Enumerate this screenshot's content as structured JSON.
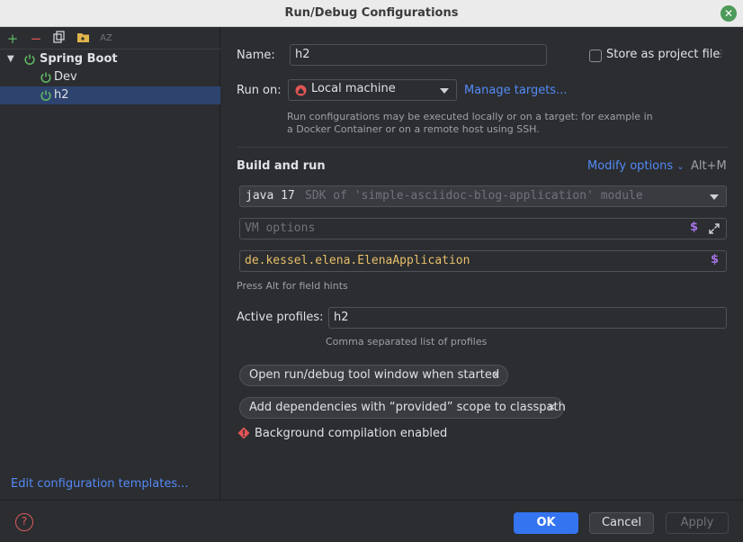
{
  "window": {
    "title": "Run/Debug Configurations"
  },
  "sidebar": {
    "toolbar": [
      {
        "name": "add",
        "glyph": "+",
        "color": "#5fb865"
      },
      {
        "name": "remove",
        "glyph": "−",
        "color": "#e05555"
      },
      {
        "name": "copy",
        "glyph": "❐",
        "color": "#ced0d6"
      },
      {
        "name": "folder",
        "glyph": "▣",
        "color": "#e0b44c"
      },
      {
        "name": "sort",
        "glyph": "AZ",
        "color": "#6f737a"
      }
    ],
    "tree": [
      {
        "label": "Spring Boot",
        "level": 0,
        "expanded": true,
        "selected": false
      },
      {
        "label": "Dev",
        "level": 1,
        "expanded": false,
        "selected": false
      },
      {
        "label": "h2",
        "level": 1,
        "expanded": false,
        "selected": true
      }
    ],
    "edit_templates": "Edit configuration templates..."
  },
  "form": {
    "name_label": "Name:",
    "name_value": "h2",
    "store_label": "Store as project file",
    "store_checked": false,
    "run_on_label": "Run on:",
    "run_on_value": "Local machine",
    "manage_targets": "Manage targets...",
    "run_on_hint_1": "Run configurations may be executed locally or on a target: for example in",
    "run_on_hint_2": "a Docker Container or on a remote host using SSH.",
    "build_run_title": "Build and run",
    "modify_options": "Modify options",
    "modify_shortcut": "Alt+M",
    "jdk_main": "java 17",
    "jdk_detail": "SDK of 'simple-asciidoc-blog-application' module",
    "vm_placeholder": "VM options",
    "main_class": "de.kessel.elena.ElenaApplication",
    "field_hint": "Press Alt for field hints",
    "profiles_label": "Active profiles:",
    "profiles_value": "h2",
    "profiles_hint": "Comma separated list of profiles",
    "chips": [
      "Open run/debug tool window when started",
      "Add dependencies with “provided” scope to classpath"
    ],
    "bg_compilation": "Background compilation enabled"
  },
  "buttons": {
    "ok": "OK",
    "cancel": "Cancel",
    "apply": "Apply",
    "help": "?"
  },
  "colors": {
    "accent": "#3574f0",
    "link": "#548af7",
    "selection": "#2e436e",
    "spring_green": "#5fb865"
  }
}
